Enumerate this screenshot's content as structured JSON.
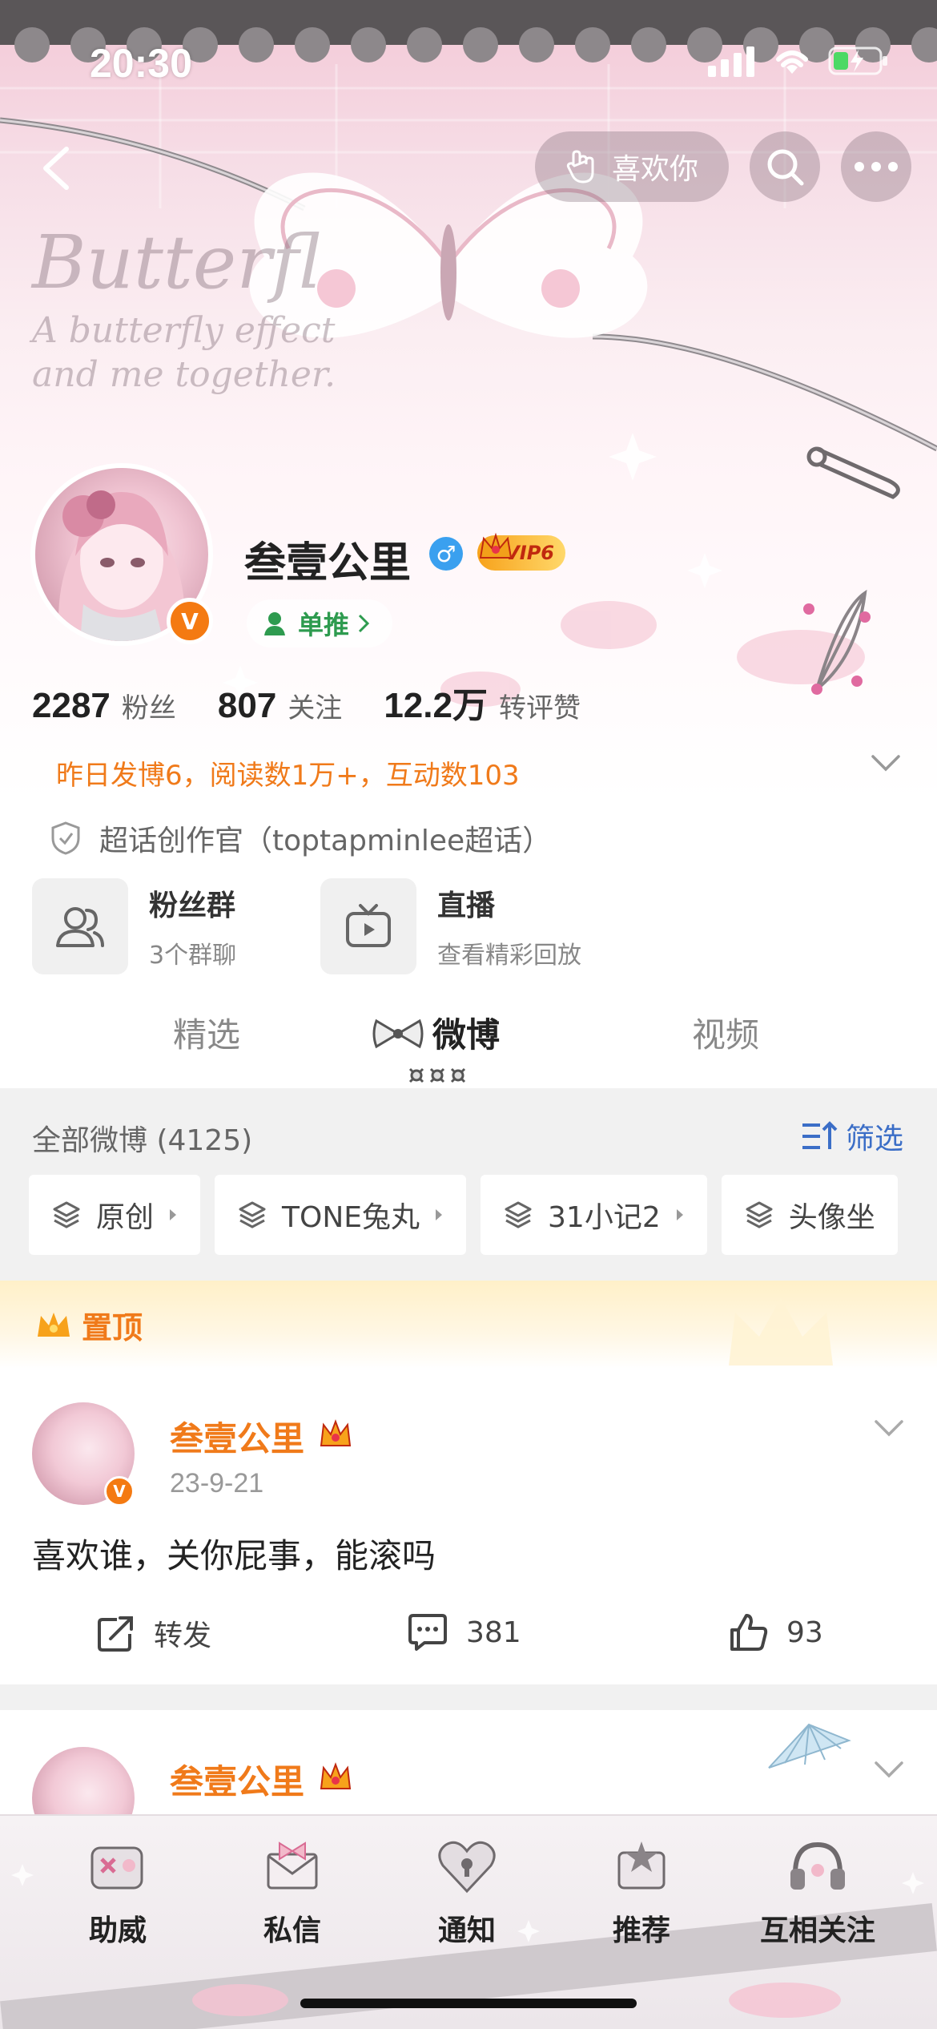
{
  "status_bar": {
    "time": "20:30"
  },
  "header": {
    "like_label": "喜欢你",
    "decor_title": "Butterfl",
    "decor_line1": "A butterfly effect",
    "decor_line2": "and me together."
  },
  "profile": {
    "name": "叁壹公里",
    "gender_symbol": "♂",
    "vip_label": "VIP6",
    "verify_mark": "V",
    "tag_label": "单推",
    "stats": [
      {
        "value": "2287",
        "label": "粉丝"
      },
      {
        "value": "807",
        "label": "关注"
      },
      {
        "value": "12.2万",
        "label": "转评赞"
      }
    ],
    "brief": "昨日发博6，阅读数1万+，互动数103",
    "super_topic": "超话创作官（toptapminlee超话）",
    "features": [
      {
        "title": "粉丝群",
        "subtitle": "3个群聊",
        "icon": "fans-group-icon"
      },
      {
        "title": "直播",
        "subtitle": "查看精彩回放",
        "icon": "live-tv-icon"
      }
    ]
  },
  "tabs": [
    {
      "label": "精选",
      "active": false
    },
    {
      "label": "微博",
      "active": true
    },
    {
      "label": "视频",
      "active": false
    }
  ],
  "feed": {
    "all_posts_label": "全部微博 (4125)",
    "filter_label": "筛选",
    "chips": [
      "原创",
      "TONE兔丸",
      "31小记2",
      "头像坐"
    ]
  },
  "pinned_label": "置顶",
  "posts": [
    {
      "author": "叁壹公里",
      "date": "23-9-21",
      "text": "喜欢谁，关你屁事，能滚吗",
      "repost_label": "转发",
      "comments": "381",
      "likes": "93"
    },
    {
      "author": "叁壹公里"
    }
  ],
  "bottom_nav": [
    "助威",
    "私信",
    "通知",
    "推荐",
    "互相关注"
  ],
  "colors": {
    "accent_orange": "#f07a1a",
    "link_blue": "#3b6ec7",
    "tag_green": "#2e9b4f",
    "verify_orange": "#f47a12"
  }
}
